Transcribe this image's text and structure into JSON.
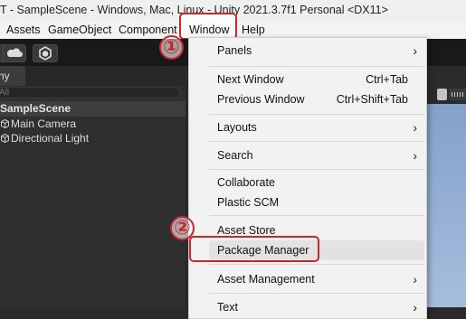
{
  "window": {
    "title": "T - SampleScene - Windows, Mac, Linux - Unity 2021.3.7f1 Personal <DX11>"
  },
  "menubar": {
    "items": [
      {
        "label": "Assets"
      },
      {
        "label": "GameObject"
      },
      {
        "label": "Component"
      },
      {
        "label": "Window"
      },
      {
        "label": "Help"
      }
    ]
  },
  "toolbar": {
    "icons": [
      "cloud-icon",
      "package-hexagon-icon"
    ]
  },
  "hierarchy": {
    "tab_label": "hy",
    "search_placeholder": "All",
    "scene_name": "SampleScene",
    "items": [
      {
        "label": "Main Camera",
        "icon": "gameobject-cube-icon"
      },
      {
        "label": "Directional Light",
        "icon": "gameobject-cube-icon"
      }
    ]
  },
  "window_menu": {
    "items": [
      {
        "label": "Panels",
        "submenu": true
      },
      {
        "label": "Next Window",
        "shortcut": "Ctrl+Tab"
      },
      {
        "label": "Previous Window",
        "shortcut": "Ctrl+Shift+Tab"
      },
      {
        "label": "Layouts",
        "submenu": true
      },
      {
        "label": "Search",
        "submenu": true
      },
      {
        "label": "Collaborate"
      },
      {
        "label": "Plastic SCM"
      },
      {
        "label": "Asset Store"
      },
      {
        "label": "Package Manager",
        "highlighted": true
      },
      {
        "label": "Asset Management",
        "submenu": true
      },
      {
        "label": "Text",
        "submenu": true
      }
    ]
  },
  "annotations": {
    "step1": "①",
    "step2": "②",
    "color": "#c8282d"
  }
}
